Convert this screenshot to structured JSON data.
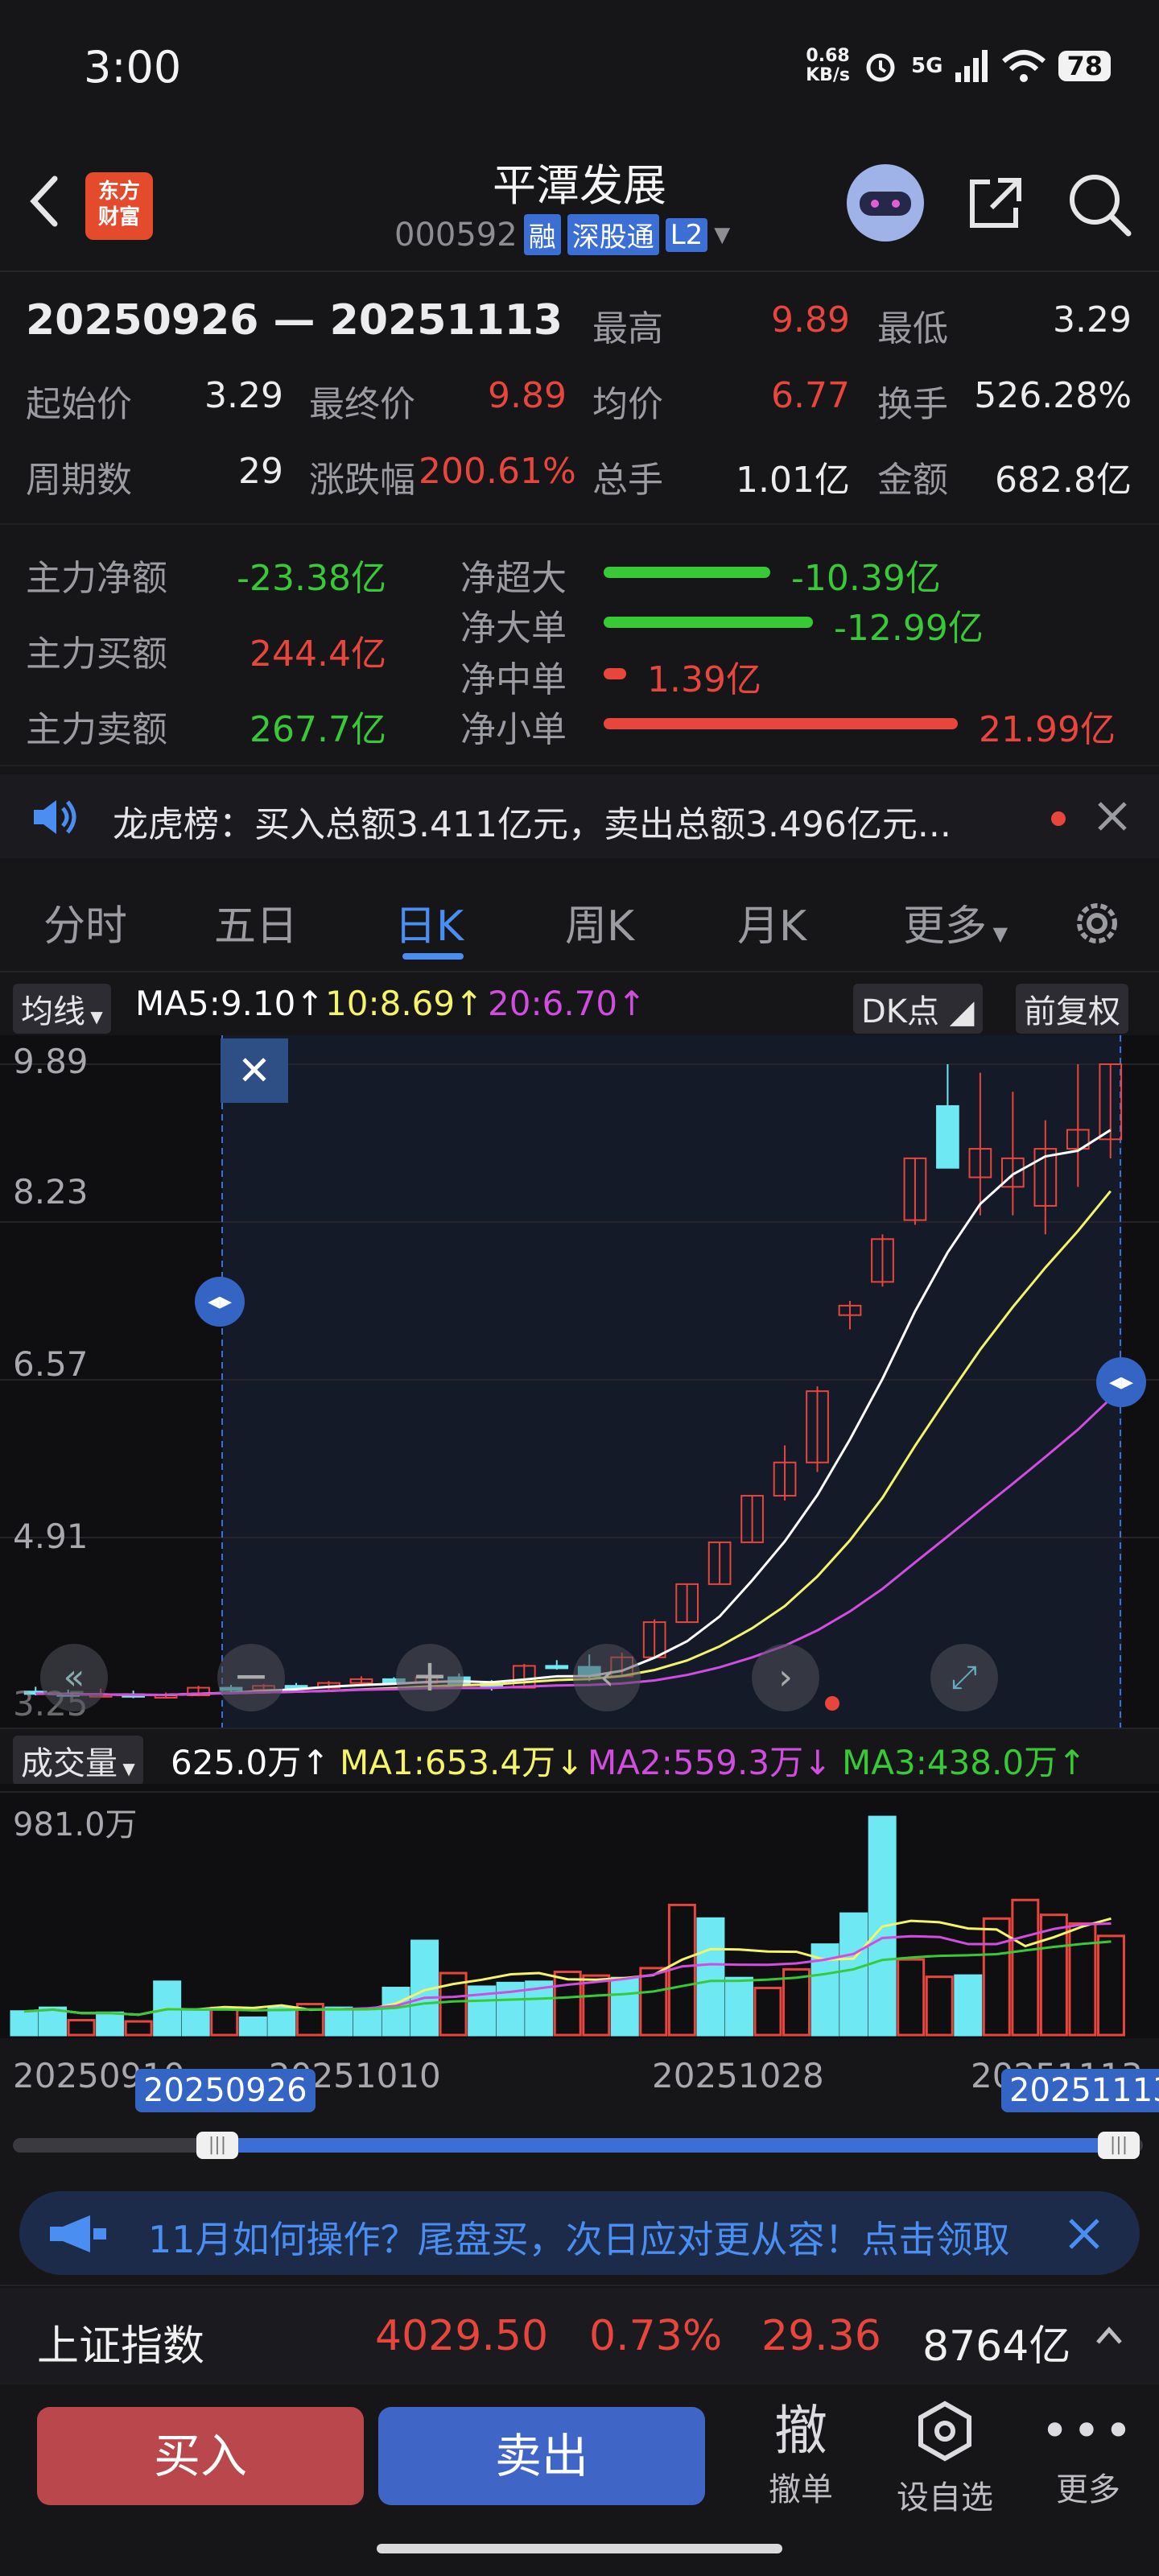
{
  "status_bar": {
    "time": "3:00",
    "net_speed_top": "0.68",
    "net_speed_unit": "KB/s",
    "network": "5G",
    "battery": "78"
  },
  "header": {
    "logo_text_1": "东方",
    "logo_text_2": "财富",
    "title": "平潭发展",
    "code": "000592",
    "tags": [
      "融",
      "深股通",
      "L2"
    ]
  },
  "range": {
    "label": "20250926 — 20251113"
  },
  "stats": {
    "high_label": "最高",
    "high": "9.89",
    "low_label": "最低",
    "low": "3.29",
    "start_label": "起始价",
    "start": "3.29",
    "end_label": "最终价",
    "end": "9.89",
    "avg_label": "均价",
    "avg": "6.77",
    "turn_label": "换手",
    "turn": "526.28%",
    "period_label": "周期数",
    "period": "29",
    "chg_label": "涨跌幅",
    "chg": "200.61%",
    "vol_label": "总手",
    "vol": "1.01亿",
    "amt_label": "金额",
    "amt": "682.8亿"
  },
  "flow": {
    "net_label": "主力净额",
    "net": "-23.38亿",
    "buy_label": "主力买额",
    "buy": "244.4亿",
    "sell_label": "主力卖额",
    "sell": "267.7亿",
    "rows": [
      {
        "label": "净超大",
        "value": "-10.39亿",
        "color": "#37c936",
        "ratio": 0.47
      },
      {
        "label": "净大单",
        "value": "-12.99亿",
        "color": "#37c936",
        "ratio": 0.59
      },
      {
        "label": "净中单",
        "value": "1.39亿",
        "color": "#e8453c",
        "ratio": 0.06
      },
      {
        "label": "净小单",
        "value": "21.99亿",
        "color": "#e8453c",
        "ratio": 1.0
      }
    ]
  },
  "notice": {
    "text": "龙虎榜：买入总额3.411亿元，卖出总额3.496亿元..."
  },
  "tabs": [
    "分时",
    "五日",
    "日K",
    "周K",
    "月K",
    "更多"
  ],
  "ma_bar": {
    "selector": "均线",
    "ma5": "MA5:9.10",
    "ma10": "10:8.69",
    "ma20": "20:6.70",
    "dk": "DK点",
    "fq": "前复权"
  },
  "price_axis": [
    "9.89",
    "8.23",
    "6.57",
    "4.91",
    "3.25"
  ],
  "volume_bar": {
    "selector": "成交量",
    "vol": "625.0万",
    "ma1": "MA1:653.4万",
    "ma2": "MA2:559.3万",
    "ma3": "MA3:438.0万",
    "max": "981.0万"
  },
  "dates": [
    "20250910",
    "20251010",
    "20251028",
    "20251113"
  ],
  "range_markers": {
    "start": "20250926",
    "end": "20251113"
  },
  "promo": {
    "text": "11月如何操作？尾盘买，次日应对更从容！点击领取"
  },
  "index": {
    "name": "上证指数",
    "price": "4029.50",
    "pct": "0.73%",
    "chg": "29.36",
    "amount": "8764亿"
  },
  "actions": {
    "buy": "买入",
    "sell": "卖出",
    "cancel_icon": "撤",
    "cancel": "撤单",
    "watch": "设自选",
    "more": "更多"
  },
  "colors": {
    "up": "#e8453c",
    "down": "#6ee8f2",
    "ma5": "#ffffff",
    "ma10": "#f4f46a",
    "ma20": "#d14ddf",
    "accent": "#4a8ef2"
  },
  "chart_data": {
    "type": "candlestick",
    "ylim": [
      3.25,
      9.89
    ],
    "candles": [
      [
        3.29,
        3.34,
        3.25,
        3.27
      ],
      [
        3.27,
        3.31,
        3.24,
        3.25
      ],
      [
        3.25,
        3.32,
        3.23,
        3.26
      ],
      [
        3.26,
        3.3,
        3.22,
        3.24
      ],
      [
        3.24,
        3.28,
        3.22,
        3.25
      ],
      [
        3.25,
        3.35,
        3.24,
        3.33
      ],
      [
        3.33,
        3.36,
        3.28,
        3.31
      ],
      [
        3.31,
        3.37,
        3.29,
        3.35
      ],
      [
        3.35,
        3.38,
        3.3,
        3.33
      ],
      [
        3.33,
        3.4,
        3.31,
        3.38
      ],
      [
        3.38,
        3.45,
        3.35,
        3.42
      ],
      [
        3.42,
        3.44,
        3.36,
        3.38
      ],
      [
        3.38,
        3.46,
        3.37,
        3.44
      ],
      [
        3.44,
        3.48,
        3.35,
        3.37
      ],
      [
        3.37,
        3.41,
        3.3,
        3.33
      ],
      [
        3.33,
        3.58,
        3.32,
        3.56
      ],
      [
        3.56,
        3.62,
        3.52,
        3.55
      ],
      [
        3.55,
        3.68,
        3.4,
        3.45
      ],
      [
        3.45,
        3.7,
        3.44,
        3.65
      ],
      [
        3.65,
        4.05,
        3.64,
        4.02
      ],
      [
        4.02,
        4.42,
        4.02,
        4.42
      ],
      [
        4.42,
        4.86,
        4.42,
        4.86
      ],
      [
        4.86,
        5.35,
        4.86,
        5.35
      ],
      [
        5.35,
        5.88,
        5.3,
        5.7
      ],
      [
        5.7,
        6.5,
        5.6,
        6.45
      ],
      [
        7.25,
        7.4,
        7.1,
        7.35
      ],
      [
        7.6,
        8.1,
        7.55,
        8.05
      ],
      [
        8.25,
        8.9,
        8.2,
        8.9
      ],
      [
        9.45,
        9.89,
        8.8,
        8.8
      ],
      [
        8.7,
        9.8,
        8.3,
        9.0
      ],
      [
        8.6,
        9.6,
        8.3,
        8.9
      ],
      [
        8.4,
        9.3,
        8.1,
        9.0
      ],
      [
        9.0,
        9.89,
        8.6,
        9.2
      ],
      [
        9.1,
        9.89,
        8.9,
        9.89
      ]
    ],
    "volume": [
      95,
      110,
      60,
      90,
      55,
      215,
      95,
      110,
      70,
      110,
      125,
      110,
      100,
      190,
      380,
      250,
      195,
      210,
      215,
      255,
      240,
      230,
      270,
      525,
      470,
      230,
      190,
      265,
      365,
      490,
      880,
      305,
      235,
      240,
      470,
      545,
      485,
      450,
      400
    ],
    "volume_max": 981.0
  }
}
